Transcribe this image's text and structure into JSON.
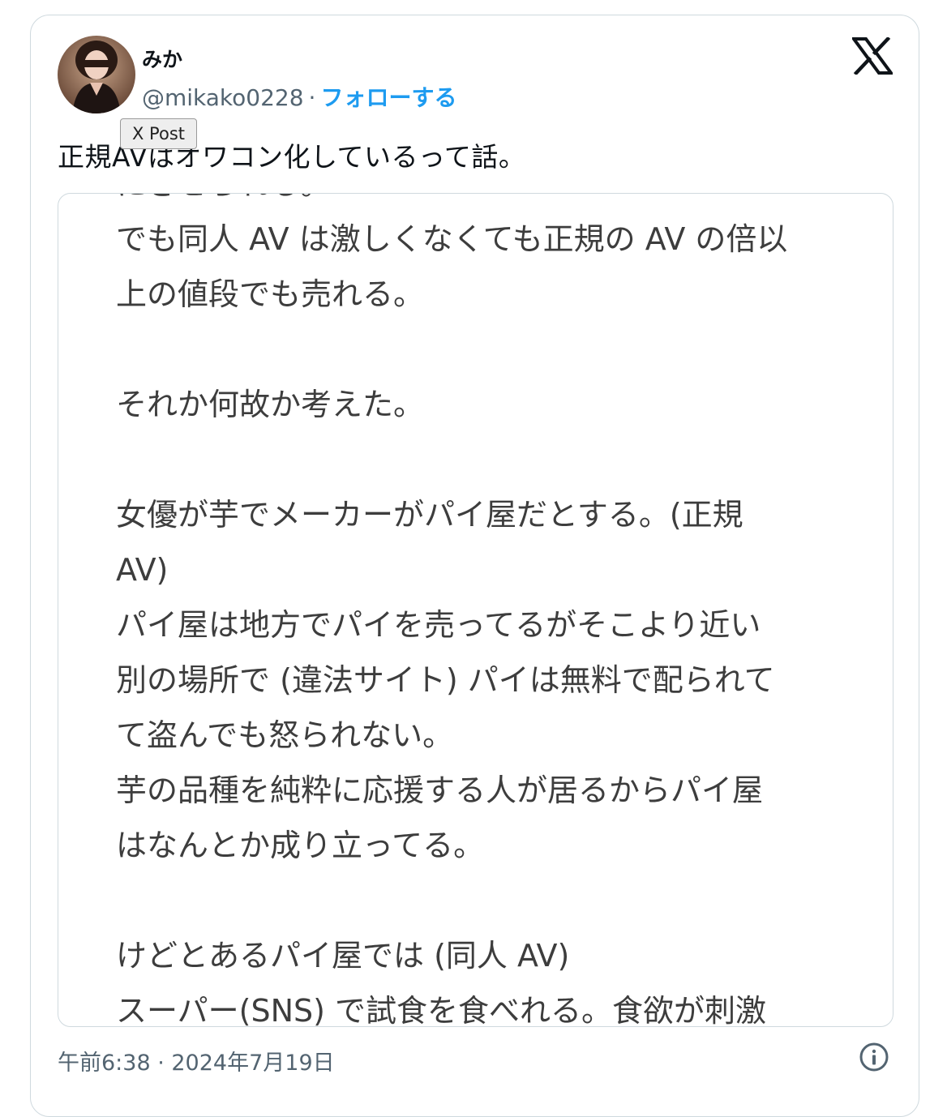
{
  "author": {
    "display_name": "みか",
    "handle": "@mikako0228",
    "separator": "·",
    "follow_label": "フォローする",
    "avatar_icon": "profile-photo-avatar"
  },
  "brand": {
    "logo_icon": "x-logo-icon"
  },
  "tooltip": {
    "text": "X Post"
  },
  "tweet": {
    "text": "正規AVはオワコン化しているって話。"
  },
  "media": {
    "lines": [
      "にさせられる。",
      "でも同人 AV は激しくなくても正規の AV の倍以",
      "上の値段でも売れる。",
      "",
      "それか何故か考えた。",
      "",
      "女優が芋でメーカーがパイ屋だとする。(正規",
      " AV)",
      "パイ屋は地方でパイを売ってるがそこより近い",
      "別の場所で (違法サイト) パイは無料で配られて",
      "て盗んでも怒られない。",
      "芋の品種を純粋に応援する人が居るからパイ屋",
      "はなんとか成り立ってる。",
      "",
      "けどとあるパイ屋では (同人 AV)",
      "スーパー(SNS) で試食を食べれる。食欲が刺激"
    ]
  },
  "footer": {
    "timestamp": "午前6:38 · 2024年7月19日",
    "info_icon": "info-icon"
  },
  "colors": {
    "text_primary": "#0f1419",
    "text_secondary": "#536471",
    "accent": "#1d9bf0",
    "border": "#cfd9de"
  }
}
